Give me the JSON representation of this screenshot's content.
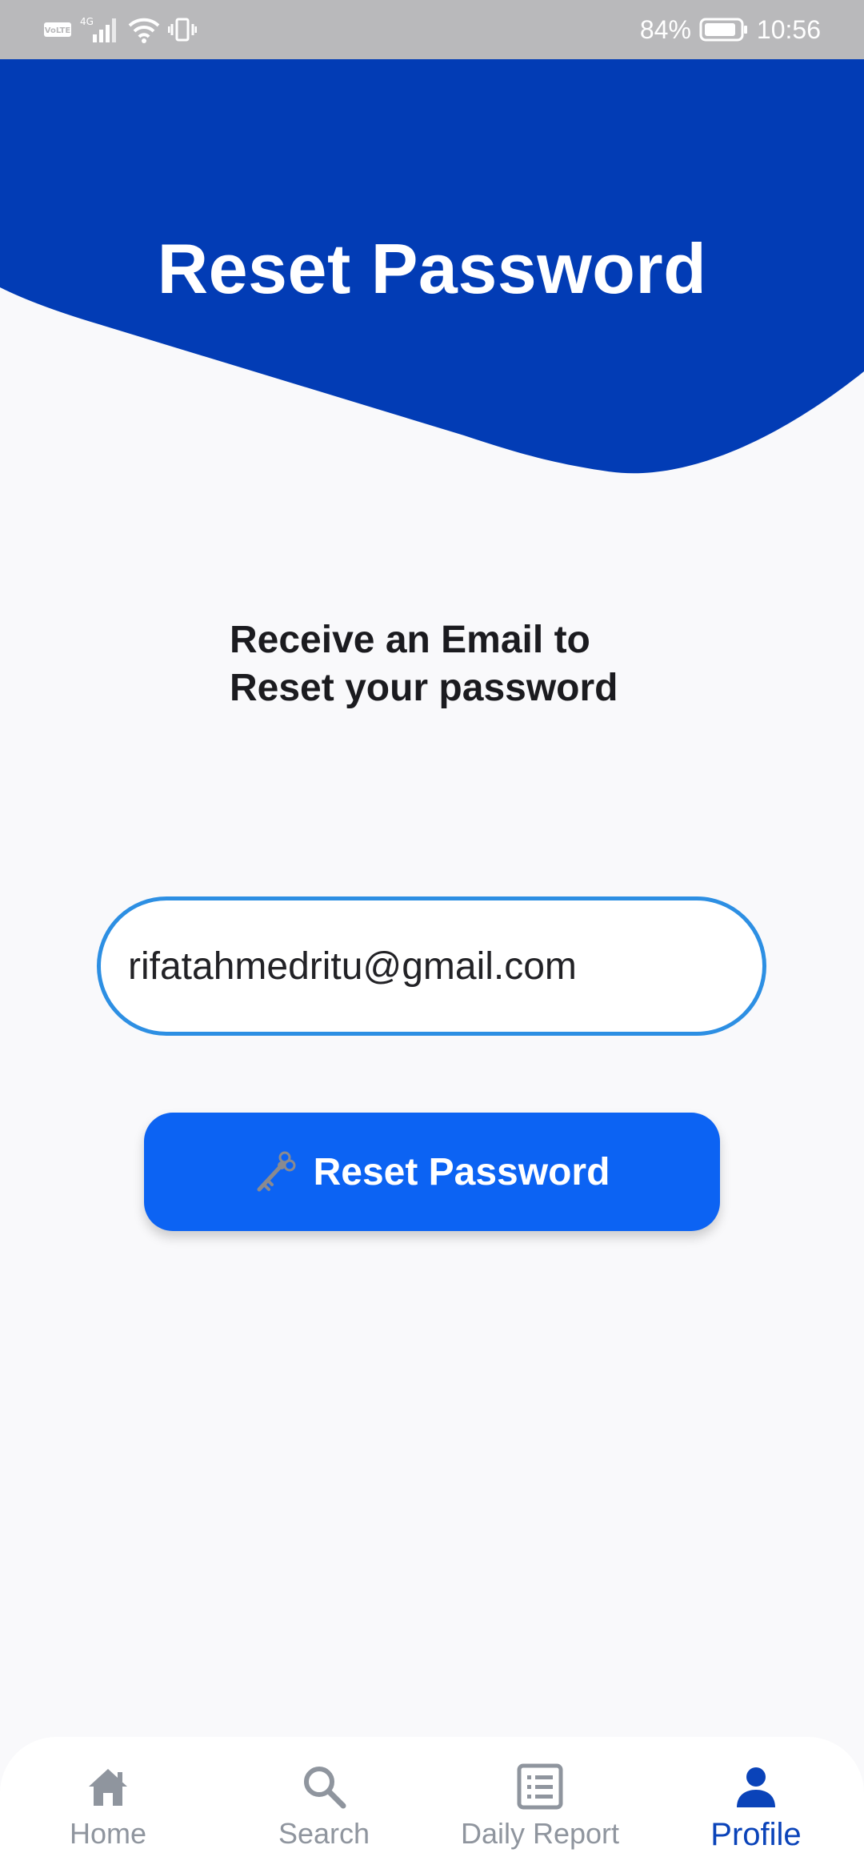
{
  "status_bar": {
    "battery": "84%",
    "time": "10:56"
  },
  "header": {
    "title": "Reset Password",
    "color": "#023cb5"
  },
  "instruction": {
    "line1": "Receive an Email to",
    "line2": "Reset your password"
  },
  "email_field": {
    "value": "rifatahmedritu@gmail.com"
  },
  "reset_button": {
    "label": "Reset Password",
    "icon": "key-icon",
    "color": "#0c63f3"
  },
  "bottom_nav": {
    "items": [
      {
        "label": "Home",
        "icon": "home-icon"
      },
      {
        "label": "Search",
        "icon": "search-icon"
      },
      {
        "label": "Daily Report",
        "icon": "report-icon"
      },
      {
        "label": "Profile",
        "icon": "profile-icon"
      }
    ],
    "active": "Profile",
    "active_color": "#0a43b9",
    "inactive_color": "#8f959e"
  }
}
